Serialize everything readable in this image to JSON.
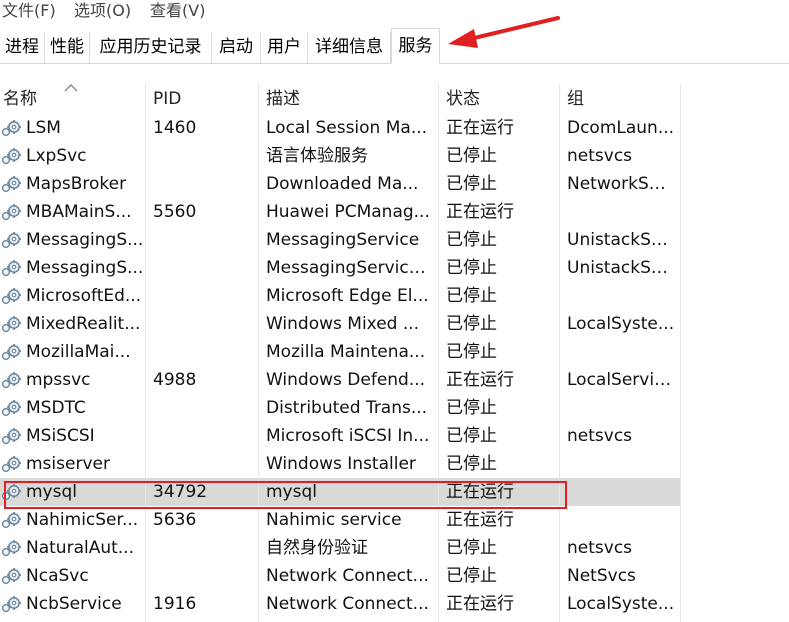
{
  "menu": [
    "文件(F)",
    "选项(O)",
    "查看(V)"
  ],
  "tabs": [
    "进程",
    "性能",
    "应用历史记录",
    "启动",
    "用户",
    "详细信息",
    "服务"
  ],
  "active_tab": "服务",
  "columns": [
    "名称",
    "PID",
    "描述",
    "状态",
    "组"
  ],
  "rows": [
    {
      "name": "LSM",
      "pid": "1460",
      "desc": "Local Session Ma...",
      "status": "正在运行",
      "group": "DcomLaun..."
    },
    {
      "name": "LxpSvc",
      "pid": "",
      "desc": "语言体验服务",
      "status": "已停止",
      "group": "netsvcs"
    },
    {
      "name": "MapsBroker",
      "pid": "",
      "desc": "Downloaded Ma...",
      "status": "已停止",
      "group": "NetworkSe..."
    },
    {
      "name": "MBAMainS...",
      "pid": "5560",
      "desc": "Huawei PCManag...",
      "status": "正在运行",
      "group": ""
    },
    {
      "name": "MessagingS...",
      "pid": "",
      "desc": "MessagingService",
      "status": "已停止",
      "group": "UnistackSv..."
    },
    {
      "name": "MessagingS...",
      "pid": "",
      "desc": "MessagingService...",
      "status": "已停止",
      "group": "UnistackSv..."
    },
    {
      "name": "MicrosoftEd...",
      "pid": "",
      "desc": "Microsoft Edge El...",
      "status": "已停止",
      "group": ""
    },
    {
      "name": "MixedRealit...",
      "pid": "",
      "desc": "Windows Mixed ...",
      "status": "已停止",
      "group": "LocalSyste..."
    },
    {
      "name": "MozillaMai...",
      "pid": "",
      "desc": "Mozilla Maintena...",
      "status": "已停止",
      "group": ""
    },
    {
      "name": "mpssvc",
      "pid": "4988",
      "desc": "Windows Defend...",
      "status": "正在运行",
      "group": "LocalServic..."
    },
    {
      "name": "MSDTC",
      "pid": "",
      "desc": "Distributed Trans...",
      "status": "已停止",
      "group": ""
    },
    {
      "name": "MSiSCSI",
      "pid": "",
      "desc": "Microsoft iSCSI In...",
      "status": "已停止",
      "group": "netsvcs"
    },
    {
      "name": "msiserver",
      "pid": "",
      "desc": "Windows Installer",
      "status": "已停止",
      "group": ""
    },
    {
      "name": "mysql",
      "pid": "34792",
      "desc": "mysql",
      "status": "正在运行",
      "group": ""
    },
    {
      "name": "NahimicSer...",
      "pid": "5636",
      "desc": "Nahimic service",
      "status": "正在运行",
      "group": ""
    },
    {
      "name": "NaturalAut...",
      "pid": "",
      "desc": "自然身份验证",
      "status": "已停止",
      "group": "netsvcs"
    },
    {
      "name": "NcaSvc",
      "pid": "",
      "desc": "Network Connect...",
      "status": "已停止",
      "group": "NetSvcs"
    },
    {
      "name": "NcbService",
      "pid": "1916",
      "desc": "Network Connect...",
      "status": "正在运行",
      "group": "LocalSyste..."
    }
  ],
  "selected_row": 13,
  "icons": {
    "service": "gear-service-icon",
    "sort": "sort-ascending-caret-icon",
    "annotation": "red-arrow-icon"
  },
  "colors": {
    "selection": "#d9d9d9",
    "annotation": "#e02020"
  }
}
